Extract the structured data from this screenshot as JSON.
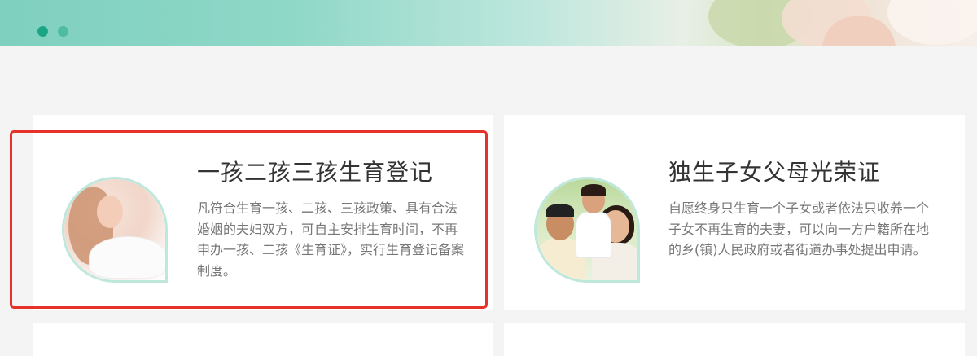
{
  "banner": {
    "dots": [
      {
        "state": "active"
      },
      {
        "state": "idle"
      }
    ],
    "accent_color": "#1aa685"
  },
  "cards": [
    {
      "title": "一孩二孩三孩生育登记",
      "description": "凡符合生育一孩、二孩、三孩政策、具有合法婚姻的夫妇双方，可自主安排生育时间，不再申办一孩、二孩《生育证》，实行生育登记备案制度。",
      "image": "pregnant-woman-photo",
      "selected": true
    },
    {
      "title": "独生子女父母光荣证",
      "description": "自愿终身只生育一个子女或者依法只收养一个子女不再生育的夫妻，可以向一方户籍所在地的乡(镇)人民政府或者街道办事处提出申请。",
      "image": "family-photo",
      "selected": false
    }
  ],
  "highlight_color": "#e5332a"
}
